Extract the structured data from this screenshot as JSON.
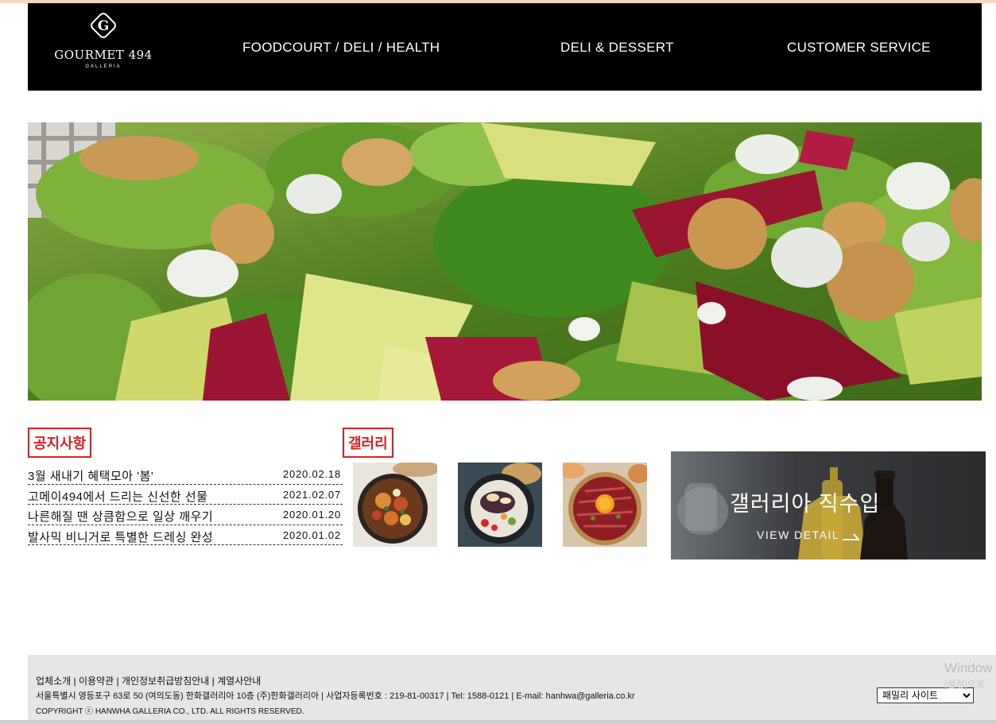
{
  "header": {
    "logo_text": "GOURMET 494",
    "logo_sub": "GALLERIA",
    "nav": [
      {
        "label": "FOODCOURT / DELI / HEALTH"
      },
      {
        "label": "DELI & DESSERT"
      },
      {
        "label": "CUSTOMER SERVICE"
      }
    ]
  },
  "notice": {
    "title": "공지사항",
    "items": [
      {
        "text": "3월 새내기 혜택모아 '봄'",
        "date": "2020.02.18"
      },
      {
        "text": "고메이494에서 드리는 신선한 선물",
        "date": "2021.02.07"
      },
      {
        "text": "나른해질 땐 상큼함으로 일상 깨우기",
        "date": "2020.01.20"
      },
      {
        "text": "발사믹 비니거로 특별한 드레싱 완성",
        "date": "2020.01.02"
      }
    ]
  },
  "gallery": {
    "title": "갤러리"
  },
  "banner": {
    "title": "갤러리아 직수입",
    "link": "VIEW DETAIL"
  },
  "footer": {
    "links": [
      "업체소개",
      "이용약관",
      "개인정보취급방침안내",
      "계열사안내"
    ],
    "address": "서울특별시 영등포구 63로 50 (여의도동) 한화갤러리아 10층 (주)한화갤러리아 | 사업자등록번호 : 219-81-00317 | Tel: 1588-0121 | E-mail: hanhwa@galleria.co.kr",
    "copyright": "COPYRIGHT ⓒ HANWHA GALLERIA CO., LTD. ALL RIGHTS RESERVED.",
    "family_site": "패밀리 사이트"
  },
  "watermark": {
    "line1": "Window",
    "line2": "[설정]으로"
  },
  "colors": {
    "header_bg": "#000000",
    "accent_red": "#e0201d",
    "footer_bg": "#e6e6e6"
  }
}
